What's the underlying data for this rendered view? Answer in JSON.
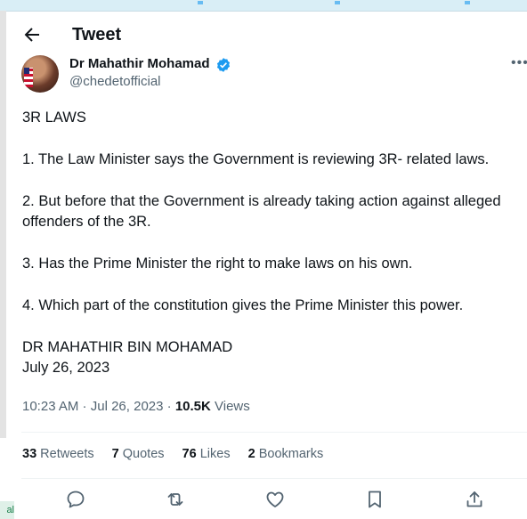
{
  "header": {
    "title": "Tweet"
  },
  "author": {
    "name": "Dr Mahathir Mohamad",
    "handle": "@chedetofficial"
  },
  "tweet": {
    "lines": [
      "3R LAWS",
      "1. The Law Minister says the Government is reviewing 3R- related laws.",
      "2. But before that the Government is already taking action against alleged offenders of the 3R.",
      "3. Has the Prime Minister the right to make laws on his own.",
      "4. Which part of the constitution gives the Prime Minister this power.",
      "DR MAHATHIR BIN MOHAMAD",
      "July 26, 2023"
    ]
  },
  "meta": {
    "time": "10:23 AM",
    "sep1": " · ",
    "date": "Jul 26, 2023",
    "sep2": " · ",
    "views_count": "10.5K",
    "views_label": " Views"
  },
  "stats": {
    "retweets_count": "33",
    "retweets_label": " Retweets",
    "quotes_count": "7",
    "quotes_label": " Quotes",
    "likes_count": "76",
    "likes_label": " Likes",
    "bookmarks_count": "2",
    "bookmarks_label": " Bookmarks"
  },
  "icons": [
    "back-arrow-icon",
    "verified-badge-icon",
    "more-icon",
    "reply-icon",
    "retweet-icon",
    "like-icon",
    "bookmark-icon",
    "share-icon"
  ],
  "colors": {
    "accent": "#1d9bf0",
    "secondary_text": "#536471",
    "primary_text": "#0f1419"
  },
  "left_edge_label": "al"
}
